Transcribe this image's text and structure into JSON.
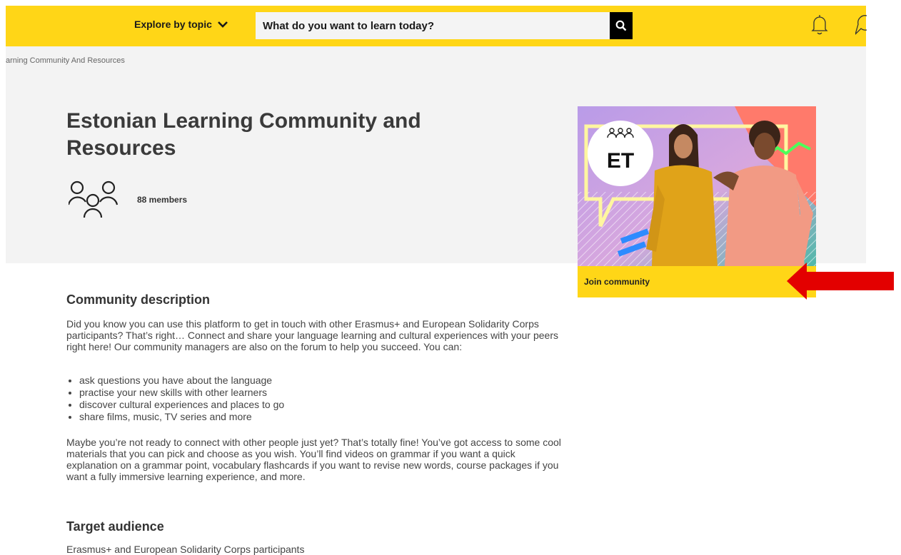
{
  "header": {
    "explore_label": "Explore by topic",
    "search_placeholder": "What do you want to learn today?",
    "icons": [
      "chevron-down-icon",
      "search-icon",
      "bell-icon",
      "chat-icon"
    ],
    "accent": "#ffd617"
  },
  "breadcrumb": "arning Community And Resources",
  "hero": {
    "title": "Estonian Learning Community and Resources",
    "members": "88 members"
  },
  "card": {
    "badge_code": "ET",
    "join_label": "Join community"
  },
  "description": {
    "heading": "Community description",
    "intro": "Did you know you can use this platform to get in touch with other Erasmus+ and European Solidarity Corps participants? That’s right… Connect and share your language learning and cultural experiences with your peers right here! Our community managers are also on the forum to help you succeed. You can:",
    "items": [
      "ask questions you have about the language",
      "practise your new skills with other learners",
      "discover cultural experiences and places to go",
      "share films, music, TV series and more"
    ],
    "more": "Maybe you’re not ready to connect with other people just yet? That’s totally fine! You’ve got access to some cool materials that you can pick and choose as you wish. You’ll find videos on grammar if you want a quick explanation on a grammar point, vocabulary flashcards if you want to revise new words, course packages if you want a fully immersive learning experience, and more."
  },
  "target": {
    "heading": "Target audience",
    "text": "Erasmus+ and European Solidarity Corps participants"
  }
}
